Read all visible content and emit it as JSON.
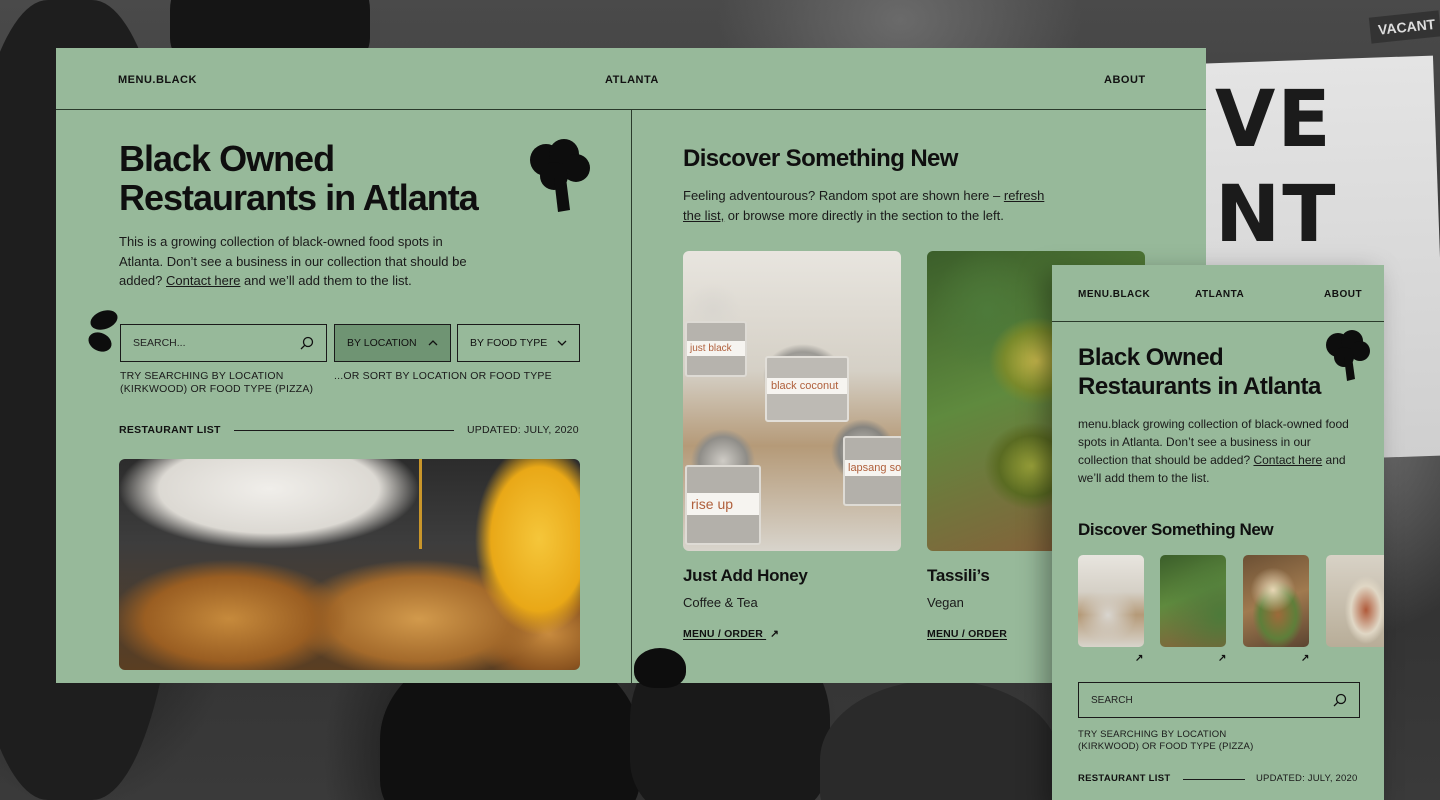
{
  "desktop": {
    "nav": {
      "brand": "MENU.BLACK",
      "city": "ATLANTA",
      "about": "ABOUT"
    },
    "hero": {
      "title_line1": "Black Owned",
      "title_line2": "Restaurants in Atlanta",
      "intro_before": "This is a growing collection of black-owned food spots in Atlanta. Don’t see a business in our collection that should be added? ",
      "intro_link": "Contact here",
      "intro_after": " and we’ll add them to the list."
    },
    "search": {
      "placeholder": "SEARCH...",
      "hint": "TRY SEARCHING BY LOCATION (KIRKWOOD) OR FOOD TYPE (PIZZA)",
      "by_location": "BY LOCATION",
      "by_food_type": "BY FOOD TYPE",
      "sort_hint": "...OR SORT BY LOCATION OR FOOD TYPE"
    },
    "list": {
      "label": "RESTAURANT LIST",
      "updated": "UPDATED: JULY, 2020"
    },
    "discover": {
      "title": "Discover Something New",
      "text_before": "Feeling adventourous? Random spot are shown here – ",
      "text_link": "refresh the list,",
      "text_after": " or browse more directly in the section to the left.",
      "cards": [
        {
          "name": "Just Add Honey",
          "category": "Coffee & Tea",
          "cta": "MENU / ORDER",
          "arrow": "↗"
        },
        {
          "name": "Tassili’s",
          "category": "Vegan",
          "cta": "MENU / ORDER"
        }
      ]
    },
    "tea_tins": [
      "just black",
      "black coconut",
      "rise up",
      "lapsang so"
    ]
  },
  "mobile": {
    "nav": {
      "brand": "MENU.BLACK",
      "city": "ATLANTA",
      "about": "ABOUT"
    },
    "hero": {
      "title_line1": "Black Owned",
      "title_line2": "Restaurants in Atlanta",
      "intro_before": "menu.black growing collection of black-owned food spots in Atlanta. Don’t see a business in our collection that should be added? ",
      "intro_link": "Contact here",
      "intro_after": " and we’ll add them to the list."
    },
    "discover_title": "Discover Something New",
    "thumb_arrows": [
      "↗",
      "↗",
      "↗"
    ],
    "search": {
      "placeholder": "SEARCH",
      "hint": "TRY SEARCHING BY LOCATION (KIRKWOOD) OR FOOD TYPE (PIZZA)"
    },
    "list": {
      "label": "RESTAURANT LIST",
      "updated": "UPDATED: JULY, 2020"
    }
  },
  "background": {
    "sign_text_1": "VE",
    "sign_text_2": "NT TO",
    "vacant": "VACANT"
  },
  "colors": {
    "panel_green": "#97b99a",
    "active_green": "#6f9473",
    "ink": "#111111"
  }
}
